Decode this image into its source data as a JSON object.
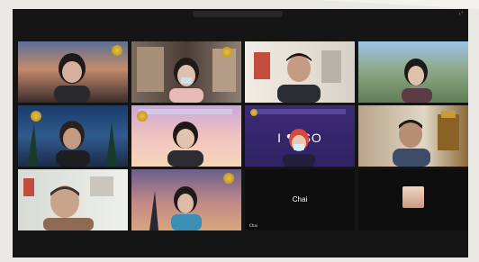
{
  "meeting": {
    "window_title": "",
    "view_control": "⤢"
  },
  "colors": {
    "page_bg": "#e9e8e3",
    "window_bg": "#151515",
    "active_speaker": "#98e07c",
    "muted": "#ff5b5b"
  },
  "tiles": [
    {
      "name": "",
      "background": "sunset-beach",
      "video": true
    },
    {
      "name": "",
      "background": "bookshelf-office",
      "video": true
    },
    {
      "name": "",
      "background": "bright-office",
      "video": true
    },
    {
      "name": "",
      "background": "campus-aerial",
      "video": true
    },
    {
      "name": "",
      "background": "tropical-night",
      "video": true
    },
    {
      "name": "",
      "background": "pastel-sky",
      "video": true
    },
    {
      "name": "",
      "background": "i-love-so-banner",
      "video": true,
      "banner_text": "I ❤ SO"
    },
    {
      "name": "",
      "background": "gold-office",
      "video": true
    },
    {
      "name": "",
      "background": "light-office",
      "video": true,
      "active_speaker": true
    },
    {
      "name": "",
      "background": "sunset-sky",
      "video": true
    },
    {
      "name": "Chai",
      "background": "black",
      "video": false
    },
    {
      "name": "",
      "background": "black",
      "video": false,
      "profile_picture": true
    }
  ]
}
